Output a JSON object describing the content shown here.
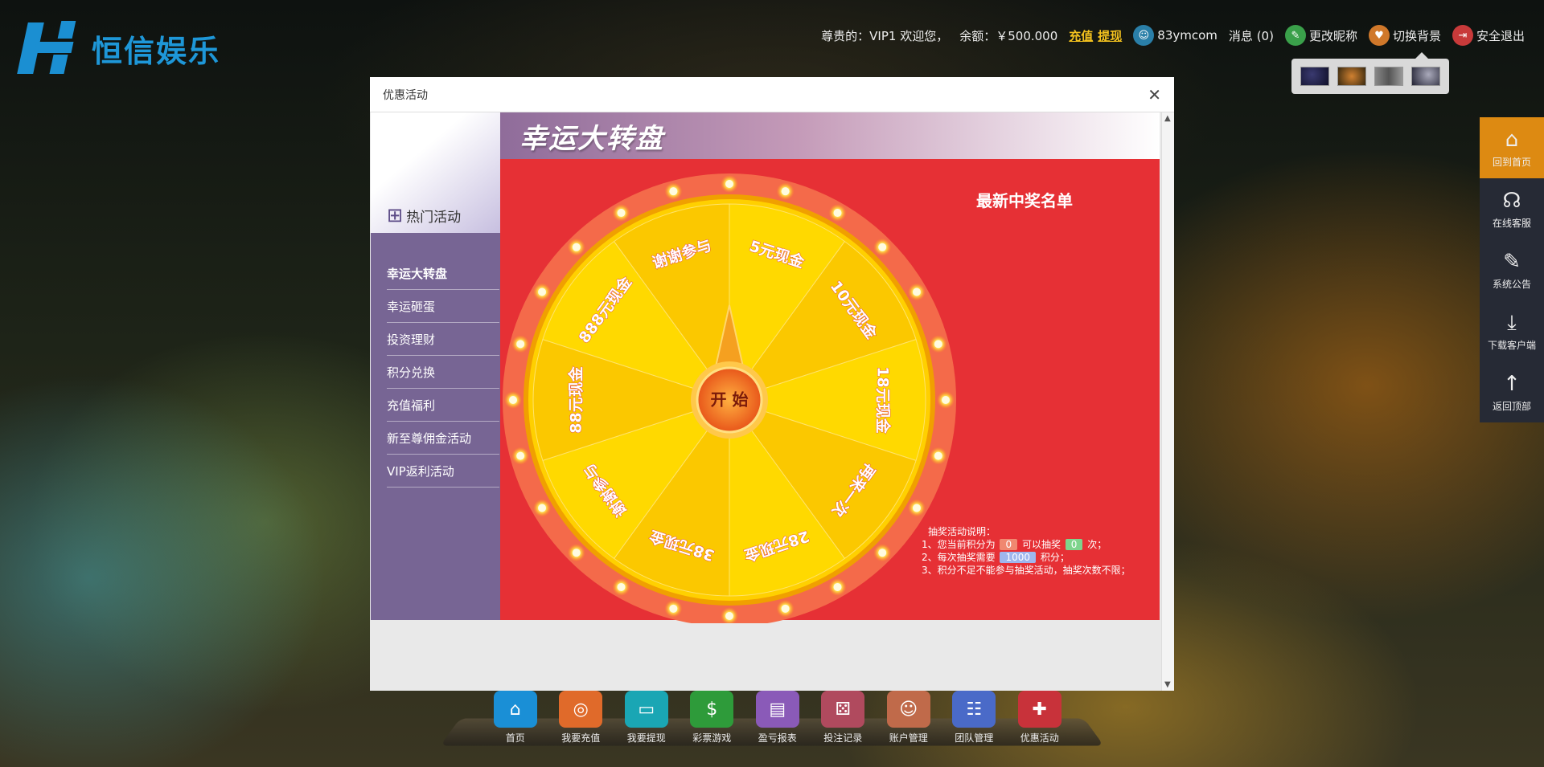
{
  "brand": {
    "name": "恒信娱乐"
  },
  "header": {
    "greeting": "尊贵的：VIP1 欢迎您，",
    "balance_label": "余额：",
    "balance_value": "￥500.000",
    "recharge": "充值",
    "withdraw": "提现",
    "username": "83ymcom",
    "messages": "消息 (0)",
    "change_nickname": "更改昵称",
    "switch_bg": "切换背景",
    "logout": "安全退出"
  },
  "colors": {
    "accent": "#dd8a12",
    "nav_purple": "#776594",
    "panel_red": "#e63035",
    "wheel_yellow": "#ffd400"
  },
  "side": [
    {
      "label": "回到首页",
      "icon": "home-icon",
      "glyph": "⌂"
    },
    {
      "label": "在线客服",
      "icon": "headset-icon",
      "glyph": "☊"
    },
    {
      "label": "系统公告",
      "icon": "pencil-icon",
      "glyph": "✎"
    },
    {
      "label": "下载客户端",
      "icon": "download-icon",
      "glyph": "⤓"
    },
    {
      "label": "返回顶部",
      "icon": "arrow-up-icon",
      "glyph": "↑"
    }
  ],
  "dock": [
    {
      "label": "首页",
      "color": "#1a8fd6",
      "icon": "home-icon",
      "glyph": "⌂"
    },
    {
      "label": "我要充值",
      "color": "#e06a2a",
      "icon": "coins-icon",
      "glyph": "◎"
    },
    {
      "label": "我要提现",
      "color": "#1aa6b4",
      "icon": "card-icon",
      "glyph": "▭"
    },
    {
      "label": "彩票游戏",
      "color": "#2e9b3a",
      "icon": "dollar-icon",
      "glyph": "$"
    },
    {
      "label": "盈亏报表",
      "color": "#8a5ab8",
      "icon": "slot-icon",
      "glyph": "▤"
    },
    {
      "label": "投注记录",
      "color": "#b04a5e",
      "icon": "dice-icon",
      "glyph": "⚄"
    },
    {
      "label": "账户管理",
      "color": "#c06a4a",
      "icon": "user-icon",
      "glyph": "☺"
    },
    {
      "label": "团队管理",
      "color": "#4a6ac8",
      "icon": "team-icon",
      "glyph": "☷"
    },
    {
      "label": "优惠活动",
      "color": "#c8323a",
      "icon": "gift-icon",
      "glyph": "✚"
    }
  ],
  "modal": {
    "title": "优惠活动",
    "hot_label": "热门活动",
    "nav": [
      "幸运大转盘",
      "幸运砸蛋",
      "投资理财",
      "积分兑换",
      "充值福利",
      "新至尊佣金活动",
      "VIP返利活动"
    ],
    "banner_title": "幸运大转盘",
    "winners_title": "最新中奖名单",
    "wheel": {
      "start_label": "开 始",
      "prizes": [
        "5元现金",
        "10元现金",
        "18元现金",
        "再来一次",
        "28元现金",
        "38元现金",
        "谢谢参与",
        "88元现金",
        "888元现金",
        "谢谢参与"
      ]
    },
    "rules": {
      "title": "抽奖活动说明：",
      "line1_a": "1、您当前积分为",
      "points": "0",
      "line1_b": "可以抽奖",
      "draws": "0",
      "line1_c": "次；",
      "line2_a": "2、每次抽奖需要",
      "cost": "1000",
      "line2_b": "积分；",
      "line3": "3、积分不足不能参与抽奖活动，抽奖次数不限；"
    }
  }
}
